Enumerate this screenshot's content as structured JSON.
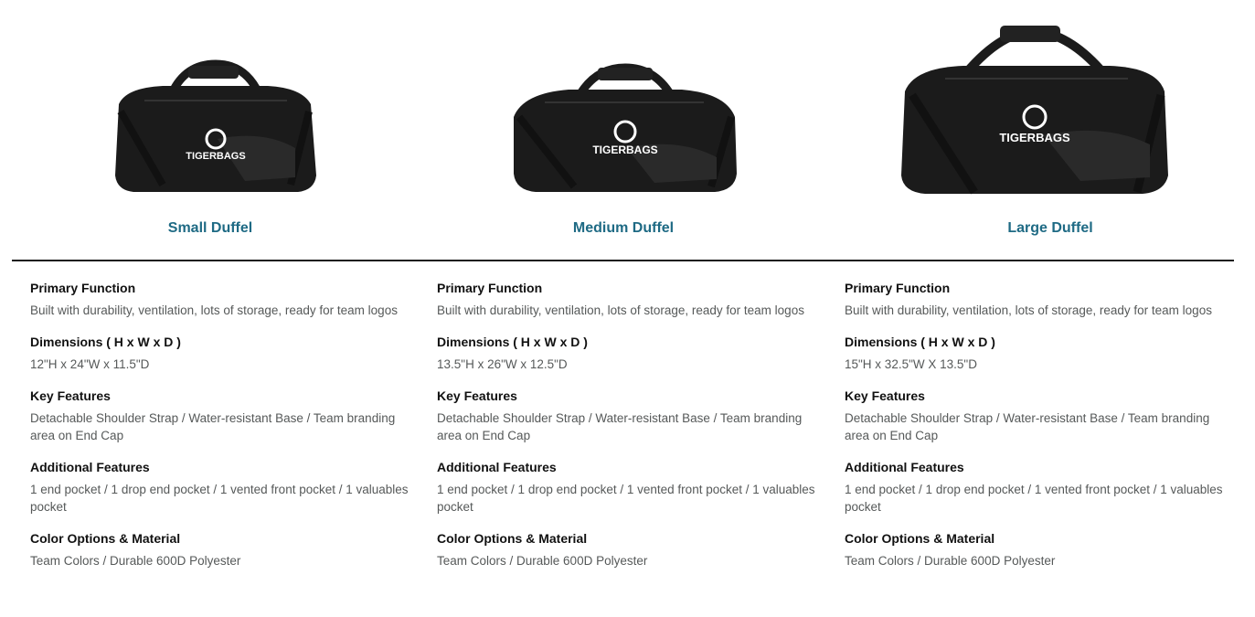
{
  "products": [
    {
      "title": "Small Duffel",
      "logo_text": "TIGERBAGS",
      "image_alt": "Small black duffel bag",
      "specs": [
        {
          "label": "Primary Function",
          "value": "Built with durability, ventilation, lots of storage, ready for team logos"
        },
        {
          "label": "Dimensions ( H x W x D )",
          "value": "12\"H x 24\"W x 11.5\"D"
        },
        {
          "label": "Key Features",
          "value": "Detachable Shoulder Strap / Water-resistant Base / Team branding area on End Cap"
        },
        {
          "label": "Additional Features",
          "value": "1 end pocket / 1 drop end pocket / 1 vented front pocket / 1 valuables pocket"
        },
        {
          "label": "Color Options & Material",
          "value": "Team Colors / Durable 600D Polyester"
        }
      ]
    },
    {
      "title": "Medium Duffel",
      "logo_text": "TIGERBAGS",
      "image_alt": "Medium black duffel bag",
      "specs": [
        {
          "label": "Primary Function",
          "value": "Built with durability, ventilation, lots of storage, ready for team logos"
        },
        {
          "label": "Dimensions ( H x W x D )",
          "value": "13.5\"H x 26\"W x 12.5\"D"
        },
        {
          "label": "Key Features",
          "value": "Detachable Shoulder Strap / Water-resistant Base / Team branding area on End Cap"
        },
        {
          "label": "Additional Features",
          "value": "1 end pocket / 1 drop end pocket / 1 vented front pocket / 1 valuables pocket"
        },
        {
          "label": "Color Options & Material",
          "value": "Team Colors / Durable 600D Polyester"
        }
      ]
    },
    {
      "title": "Large Duffel",
      "logo_text": "TIGERBAGS",
      "image_alt": "Large black duffel bag",
      "specs": [
        {
          "label": "Primary Function",
          "value": "Built with durability, ventilation, lots of storage, ready for team logos"
        },
        {
          "label": "Dimensions ( H x W x D )",
          "value": "15\"H x 32.5\"W X 13.5\"D"
        },
        {
          "label": "Key Features",
          "value": "Detachable Shoulder Strap / Water-resistant Base / Team branding area on End Cap"
        },
        {
          "label": "Additional Features",
          "value": "1 end pocket / 1 drop end pocket / 1 vented front pocket / 1 valuables pocket"
        },
        {
          "label": "Color Options & Material",
          "value": "Team Colors / Durable 600D Polyester"
        }
      ]
    }
  ],
  "colors": {
    "title_link": "#1e6a84",
    "bag": "#1b1b1b",
    "divider": "#1a1a1a"
  }
}
